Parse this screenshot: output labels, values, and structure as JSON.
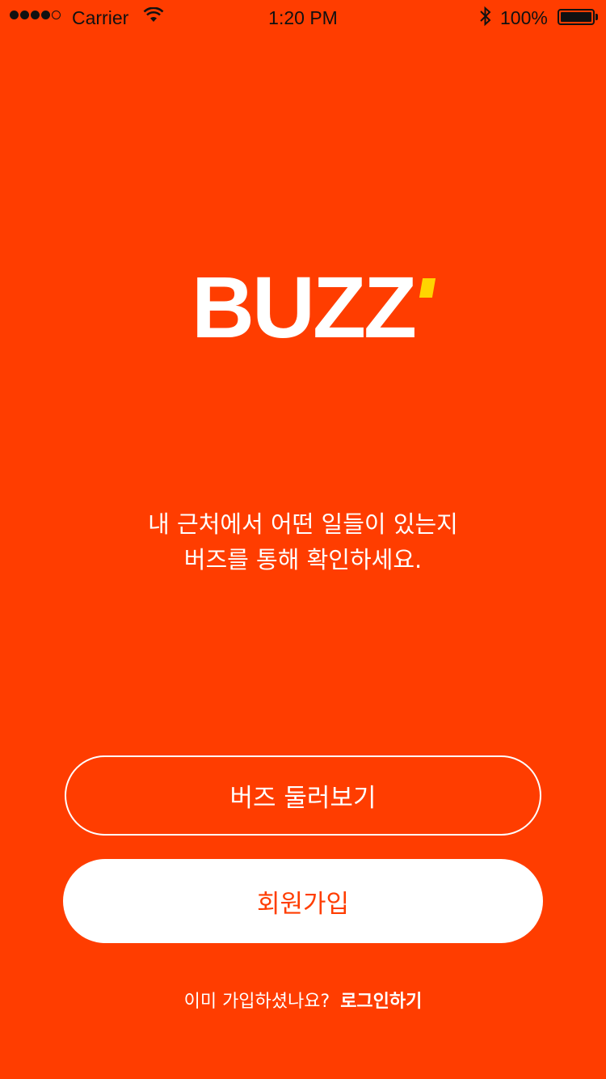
{
  "status_bar": {
    "carrier": "Carrier",
    "time": "1:20 PM",
    "battery_percent": "100%",
    "signal_bars_filled": 4,
    "signal_bars_total": 5
  },
  "logo": {
    "text": "BUZZ",
    "accent_color": "#ffd400"
  },
  "tagline": {
    "line1": "내 근처에서 어떤 일들이 있는지",
    "line2": "버즈를 통해 확인하세요."
  },
  "buttons": {
    "browse_label": "버즈 둘러보기",
    "signup_label": "회원가입"
  },
  "login": {
    "prompt": "이미 가입하셨나요?",
    "link_label": "로그인하기"
  },
  "colors": {
    "background": "#ff3d00",
    "primary_text": "#ffffff"
  }
}
